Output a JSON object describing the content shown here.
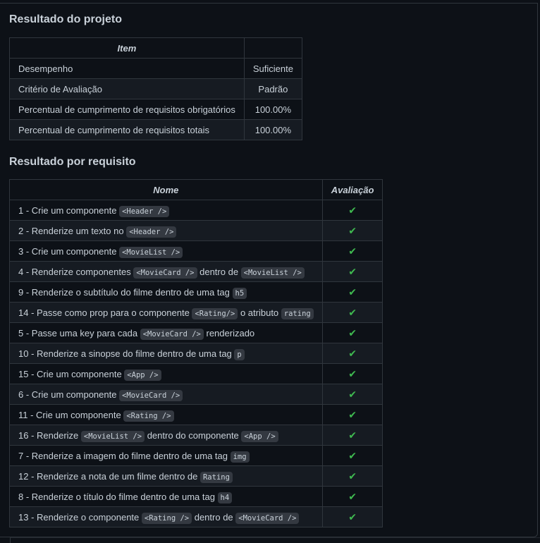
{
  "project": {
    "heading": "Resultado do projeto",
    "columns": [
      "Item",
      ""
    ],
    "rows": [
      {
        "item": "Desempenho",
        "value": "Suficiente"
      },
      {
        "item": "Critério de Avaliação",
        "value": "Padrão"
      },
      {
        "item": "Percentual de cumprimento de requisitos obrigatórios",
        "value": "100.00%"
      },
      {
        "item": "Percentual de cumprimento de requisitos totais",
        "value": "100.00%"
      }
    ]
  },
  "requirements": {
    "heading": "Resultado por requisito",
    "columns": [
      "Nome",
      "Avaliação"
    ],
    "status_glyph": "✔",
    "status_icon": "check-icon",
    "status_color": "#3fb950",
    "rows": [
      {
        "parts": [
          {
            "t": "1 - Crie um componente "
          },
          {
            "c": "<Header />"
          }
        ]
      },
      {
        "parts": [
          {
            "t": "2 - Renderize um texto no "
          },
          {
            "c": "<Header />"
          }
        ]
      },
      {
        "parts": [
          {
            "t": "3 - Crie um componente "
          },
          {
            "c": "<MovieList />"
          }
        ]
      },
      {
        "parts": [
          {
            "t": "4 - Renderize componentes "
          },
          {
            "c": "<MovieCard />"
          },
          {
            "t": " dentro de "
          },
          {
            "c": "<MovieList />"
          }
        ]
      },
      {
        "parts": [
          {
            "t": "9 - Renderize o subtítulo do filme dentro de uma tag "
          },
          {
            "c": "h5"
          }
        ]
      },
      {
        "parts": [
          {
            "t": "14 - Passe como prop para o componente "
          },
          {
            "c": "<Rating/>"
          },
          {
            "t": " o atributo "
          },
          {
            "c": "rating"
          }
        ]
      },
      {
        "parts": [
          {
            "t": "5 - Passe uma key para cada "
          },
          {
            "c": "<MovieCard />"
          },
          {
            "t": " renderizado"
          }
        ]
      },
      {
        "parts": [
          {
            "t": "10 - Renderize a sinopse do filme dentro de uma tag "
          },
          {
            "c": "p"
          }
        ]
      },
      {
        "parts": [
          {
            "t": "15 - Crie um componente "
          },
          {
            "c": "<App />"
          }
        ]
      },
      {
        "parts": [
          {
            "t": "6 - Crie um componente "
          },
          {
            "c": "<MovieCard />"
          }
        ]
      },
      {
        "parts": [
          {
            "t": "11 - Crie um componente "
          },
          {
            "c": "<Rating />"
          }
        ]
      },
      {
        "parts": [
          {
            "t": "16 - Renderize "
          },
          {
            "c": "<MovieList />"
          },
          {
            "t": " dentro do componente "
          },
          {
            "c": "<App />"
          }
        ]
      },
      {
        "parts": [
          {
            "t": "7 - Renderize a imagem do filme dentro de uma tag "
          },
          {
            "c": "img"
          }
        ]
      },
      {
        "parts": [
          {
            "t": "12 - Renderize a nota de um filme dentro de "
          },
          {
            "c": "Rating"
          }
        ]
      },
      {
        "parts": [
          {
            "t": "8 - Renderize o título do filme dentro de uma tag "
          },
          {
            "c": "h4"
          }
        ]
      },
      {
        "parts": [
          {
            "t": "13 - Renderize o componente "
          },
          {
            "c": "<Rating />"
          },
          {
            "t": " dentro de "
          },
          {
            "c": "<MovieCard />"
          }
        ]
      }
    ]
  }
}
